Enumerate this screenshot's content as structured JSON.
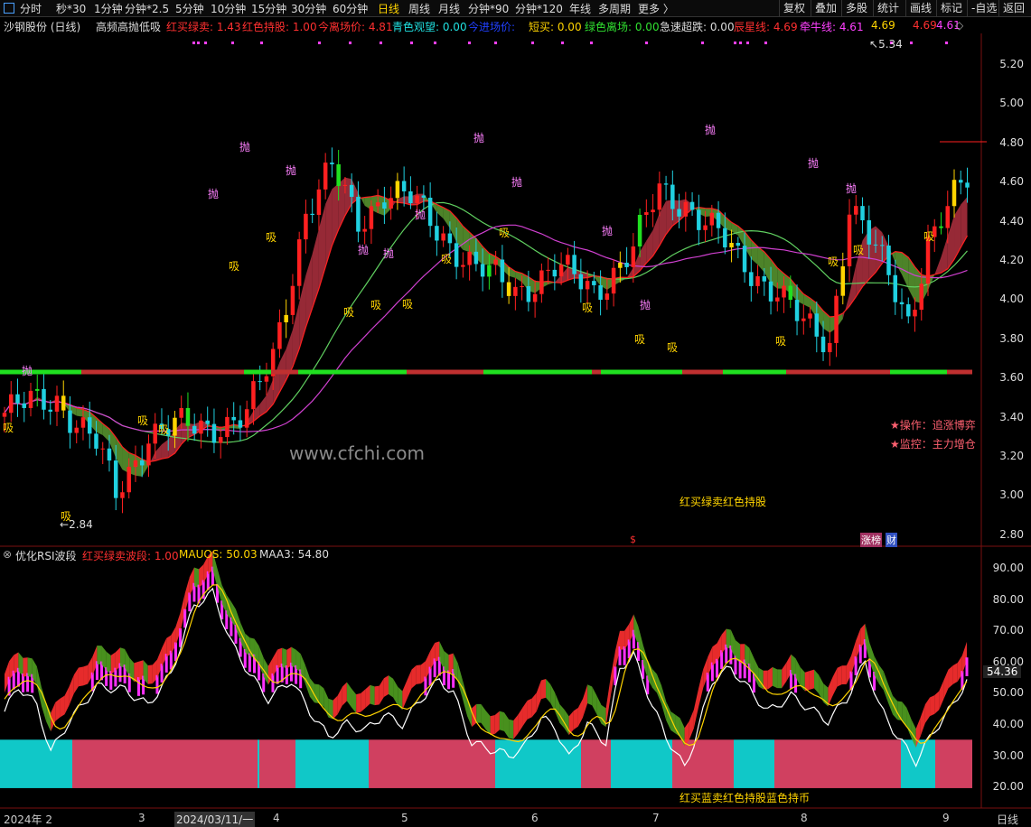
{
  "toolbar": {
    "periods": [
      "分时",
      "秒*30",
      "1分钟",
      "分钟*2.5",
      "5分钟",
      "10分钟",
      "15分钟",
      "30分钟",
      "60分钟",
      "日线",
      "周线",
      "月线",
      "分钟*90",
      "分钟*120",
      "年线",
      "多周期",
      "更多 〉"
    ],
    "active": "日线",
    "right_buttons": [
      "复权",
      "叠加",
      "多股",
      "统计",
      "画线",
      "标记",
      "-自选",
      "返回"
    ]
  },
  "info": {
    "stock": "沙钢股份 (日线)",
    "indicator": "高频高抛低吸",
    "items": [
      {
        "label": "红买绿卖: 1.43",
        "color": "#ff3030"
      },
      {
        "label": "红色持股: 1.00",
        "color": "#ff3030"
      },
      {
        "label": "今离场价: 4.81",
        "color": "#ff3030"
      },
      {
        "label": "青色观望: 0.00",
        "color": "#20e0e0"
      },
      {
        "label": "今进场价:",
        "color": "#2040ff"
      },
      {
        "label": "短买: 0.00",
        "color": "#ffd400"
      },
      {
        "label": "绿色离场: 0.00",
        "color": "#30e030"
      },
      {
        "label": "急速超跌: 0.00",
        "color": "#dddddd"
      },
      {
        "label": "辰星线: 4.69",
        "color": "#ff3030"
      },
      {
        "label": "牵牛线: 4.61",
        "color": "#ff40ff"
      },
      {
        "label": "4.69",
        "color": "#ffd400"
      },
      {
        "label": "4.69",
        "color": "#ff3030"
      },
      {
        "label": "4.61",
        "color": "#ff40ff"
      }
    ]
  },
  "main_chart": {
    "price_axis": [
      "5.20",
      "5.00",
      "4.80",
      "4.60",
      "4.40",
      "4.20",
      "4.00",
      "3.80",
      "3.60",
      "3.40",
      "3.20",
      "3.00",
      "2.80"
    ],
    "high_label": "5.34",
    "low_label": "2.84",
    "watermark": "www.cfchi.com",
    "operate": "★操作：追涨博弈",
    "monitor": "★监控：主力增仓",
    "legend_text": "红买绿卖红色持股",
    "sell_mark": "抛",
    "buy_mark": "吸",
    "event_s": "$",
    "event_zt": "涨榜",
    "event_cai": "财"
  },
  "rsi_panel": {
    "title": "优化RSI波段",
    "items": [
      {
        "label": "红买绿卖波段: 1.00",
        "color": "#ff3030"
      },
      {
        "label": "MAUOS: 50.03",
        "color": "#ffd400"
      },
      {
        "label": "MAA3: 54.80",
        "color": "#dddddd"
      }
    ],
    "axis": [
      "90.00",
      "80.00",
      "70.00",
      "60.00",
      "50.00",
      "40.00",
      "30.00",
      "20.00"
    ],
    "current": "54.36",
    "legend_text": "红买蓝卖红色持股蓝色持币"
  },
  "date_axis": {
    "labels": [
      "2024年 2",
      "3",
      "2024/03/11/一",
      "4",
      "5",
      "6",
      "7",
      "8",
      "9"
    ],
    "period": "日线"
  },
  "colors": {
    "up": "#ff2020",
    "down": "#20d0e0",
    "ma_red": "#ff2020",
    "ma_mag": "#d040d0",
    "ma_green": "#60d060",
    "band_red": "#d04060",
    "band_cyan": "#10c8c8"
  }
}
